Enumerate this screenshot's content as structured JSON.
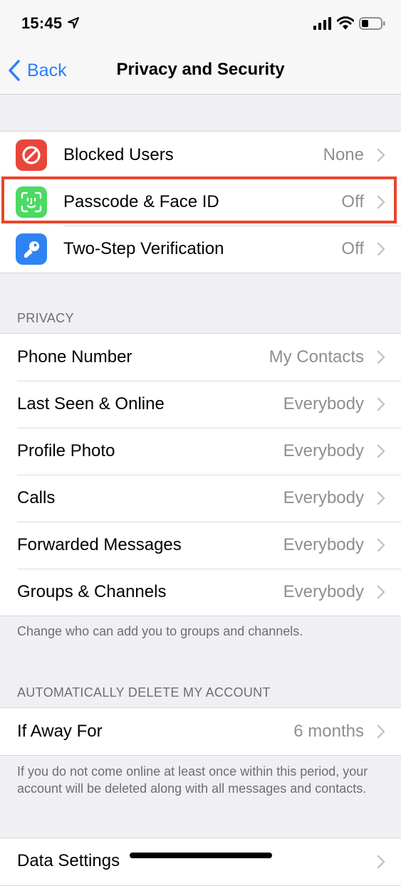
{
  "status_bar": {
    "time": "15:45",
    "icons": [
      "location-arrow-icon",
      "cellular-signal-icon",
      "wifi-icon",
      "battery-icon"
    ]
  },
  "nav": {
    "back_label": "Back",
    "title": "Privacy and Security"
  },
  "security": {
    "items": [
      {
        "label": "Blocked Users",
        "value": "None",
        "icon": "blocked-icon",
        "color": "#e9463a"
      },
      {
        "label": "Passcode & Face ID",
        "value": "Off",
        "icon": "face-id-icon",
        "color": "#4cd964"
      },
      {
        "label": "Two-Step Verification",
        "value": "Off",
        "icon": "key-icon",
        "color": "#2f84f3"
      }
    ]
  },
  "privacy": {
    "header": "PRIVACY",
    "items": [
      {
        "label": "Phone Number",
        "value": "My Contacts"
      },
      {
        "label": "Last Seen & Online",
        "value": "Everybody"
      },
      {
        "label": "Profile Photo",
        "value": "Everybody"
      },
      {
        "label": "Calls",
        "value": "Everybody"
      },
      {
        "label": "Forwarded Messages",
        "value": "Everybody"
      },
      {
        "label": "Groups & Channels",
        "value": "Everybody"
      }
    ],
    "footer": "Change who can add you to groups and channels."
  },
  "auto_delete": {
    "header": "AUTOMATICALLY DELETE MY ACCOUNT",
    "items": [
      {
        "label": "If Away For",
        "value": "6 months"
      }
    ],
    "footer": "If you do not come online at least once within this period, your account will be deleted along with all messages and contacts."
  },
  "data": {
    "items": [
      {
        "label": "Data Settings",
        "value": ""
      }
    ]
  },
  "colors": {
    "accent": "#2d7ff9",
    "highlight_border": "#e8462d"
  }
}
